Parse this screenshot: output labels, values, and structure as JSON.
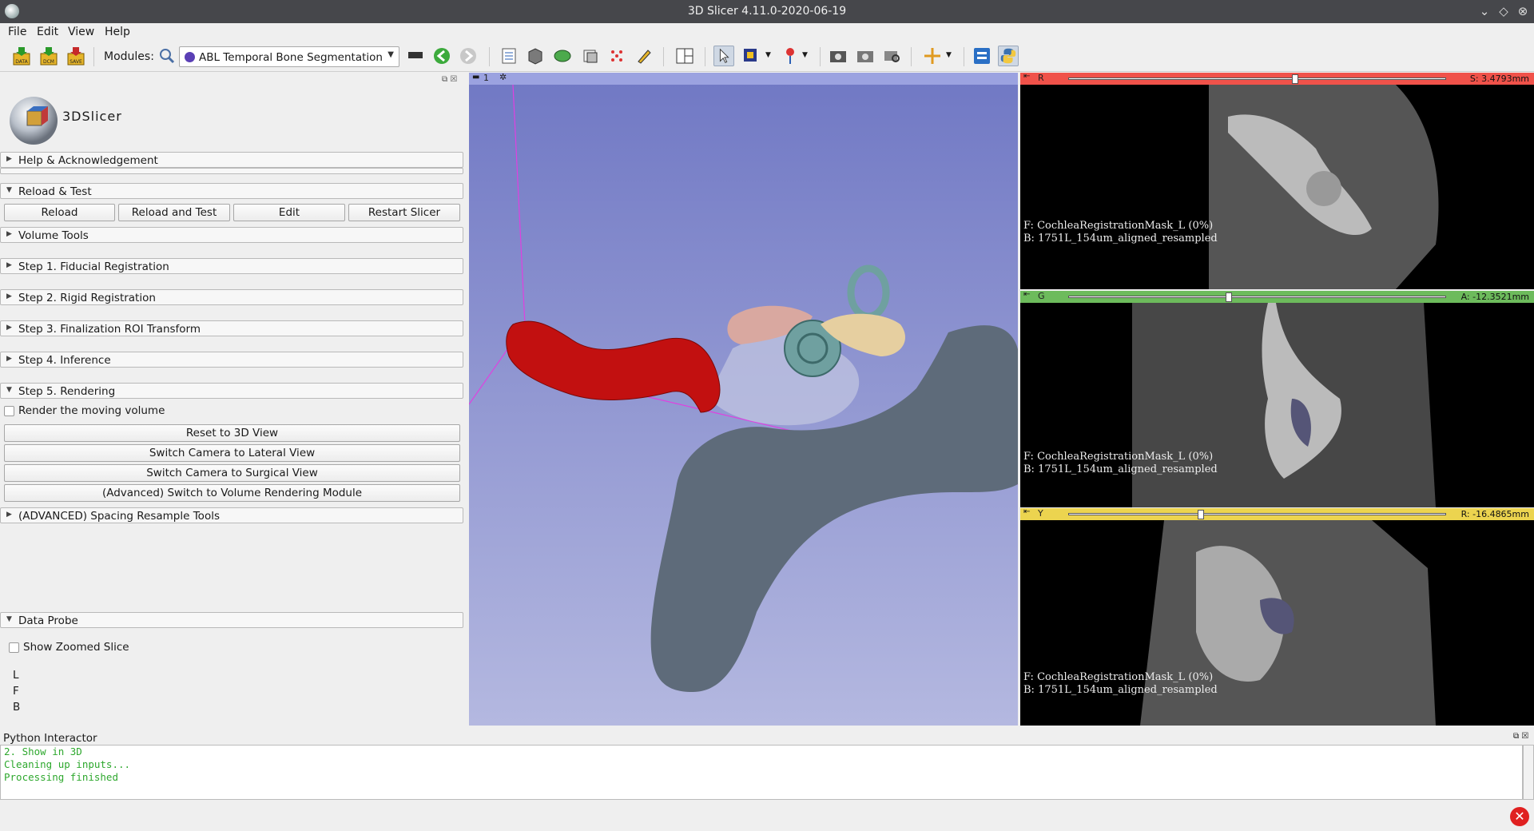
{
  "window": {
    "title": "3D Slicer 4.11.0-2020-06-19"
  },
  "menu": {
    "file": "File",
    "edit": "Edit",
    "view": "View",
    "help": "Help"
  },
  "toolbar": {
    "modules_label": "Modules:",
    "module_selected": "ABL Temporal Bone Segmentation",
    "data_label": "DATA",
    "dcm_label": "DCM",
    "save_label": "SAVE"
  },
  "logo": {
    "text": "3DSlicer"
  },
  "left_panel": {
    "sections": {
      "help": "Help & Acknowledgement",
      "reload_test": "Reload & Test",
      "volume_tools": "Volume Tools",
      "step1": "Step 1. Fiducial Registration",
      "step2": "Step 2. Rigid Registration",
      "step3": "Step 3. Finalization ROI Transform",
      "step4": "Step 4. Inference",
      "step5": "Step 5. Rendering",
      "advanced": "(ADVANCED) Spacing Resample Tools",
      "data_probe": "Data Probe"
    },
    "reload_buttons": [
      "Reload",
      "Reload and Test",
      "Edit",
      "Restart Slicer"
    ],
    "render_moving_volume": "Render the moving volume",
    "rendering_buttons": [
      "Reset to 3D View",
      "Switch Camera to Lateral View",
      "Switch Camera to Surgical View",
      "(Advanced) Switch to Volume Rendering Module"
    ],
    "data_probe": {
      "show_zoomed": "Show Zoomed Slice",
      "rows": [
        "L",
        "F",
        "B"
      ]
    }
  },
  "view3d": {
    "number": "1"
  },
  "slices": [
    {
      "letter": "R",
      "color": "#f0524a",
      "position": "S: 3.4793mm",
      "slider_fraction": 0.6,
      "fg": "F: CochleaRegistrationMask_L (0%)",
      "bg": "B: 1751L_154um_aligned_resampled"
    },
    {
      "letter": "G",
      "color": "#6dbb5c",
      "position": "A: -12.3521mm",
      "slider_fraction": 0.425,
      "fg": "F: CochleaRegistrationMask_L (0%)",
      "bg": "B: 1751L_154um_aligned_resampled"
    },
    {
      "letter": "Y",
      "color": "#ecd44f",
      "position": "R: -16.4865mm",
      "slider_fraction": 0.35,
      "fg": "F: CochleaRegistrationMask_L (0%)",
      "bg": "B: 1751L_154um_aligned_resampled"
    }
  ],
  "python": {
    "title": "Python Interactor",
    "lines": [
      "2. Show in 3D",
      "Cleaning up inputs...",
      "Processing finished"
    ]
  }
}
